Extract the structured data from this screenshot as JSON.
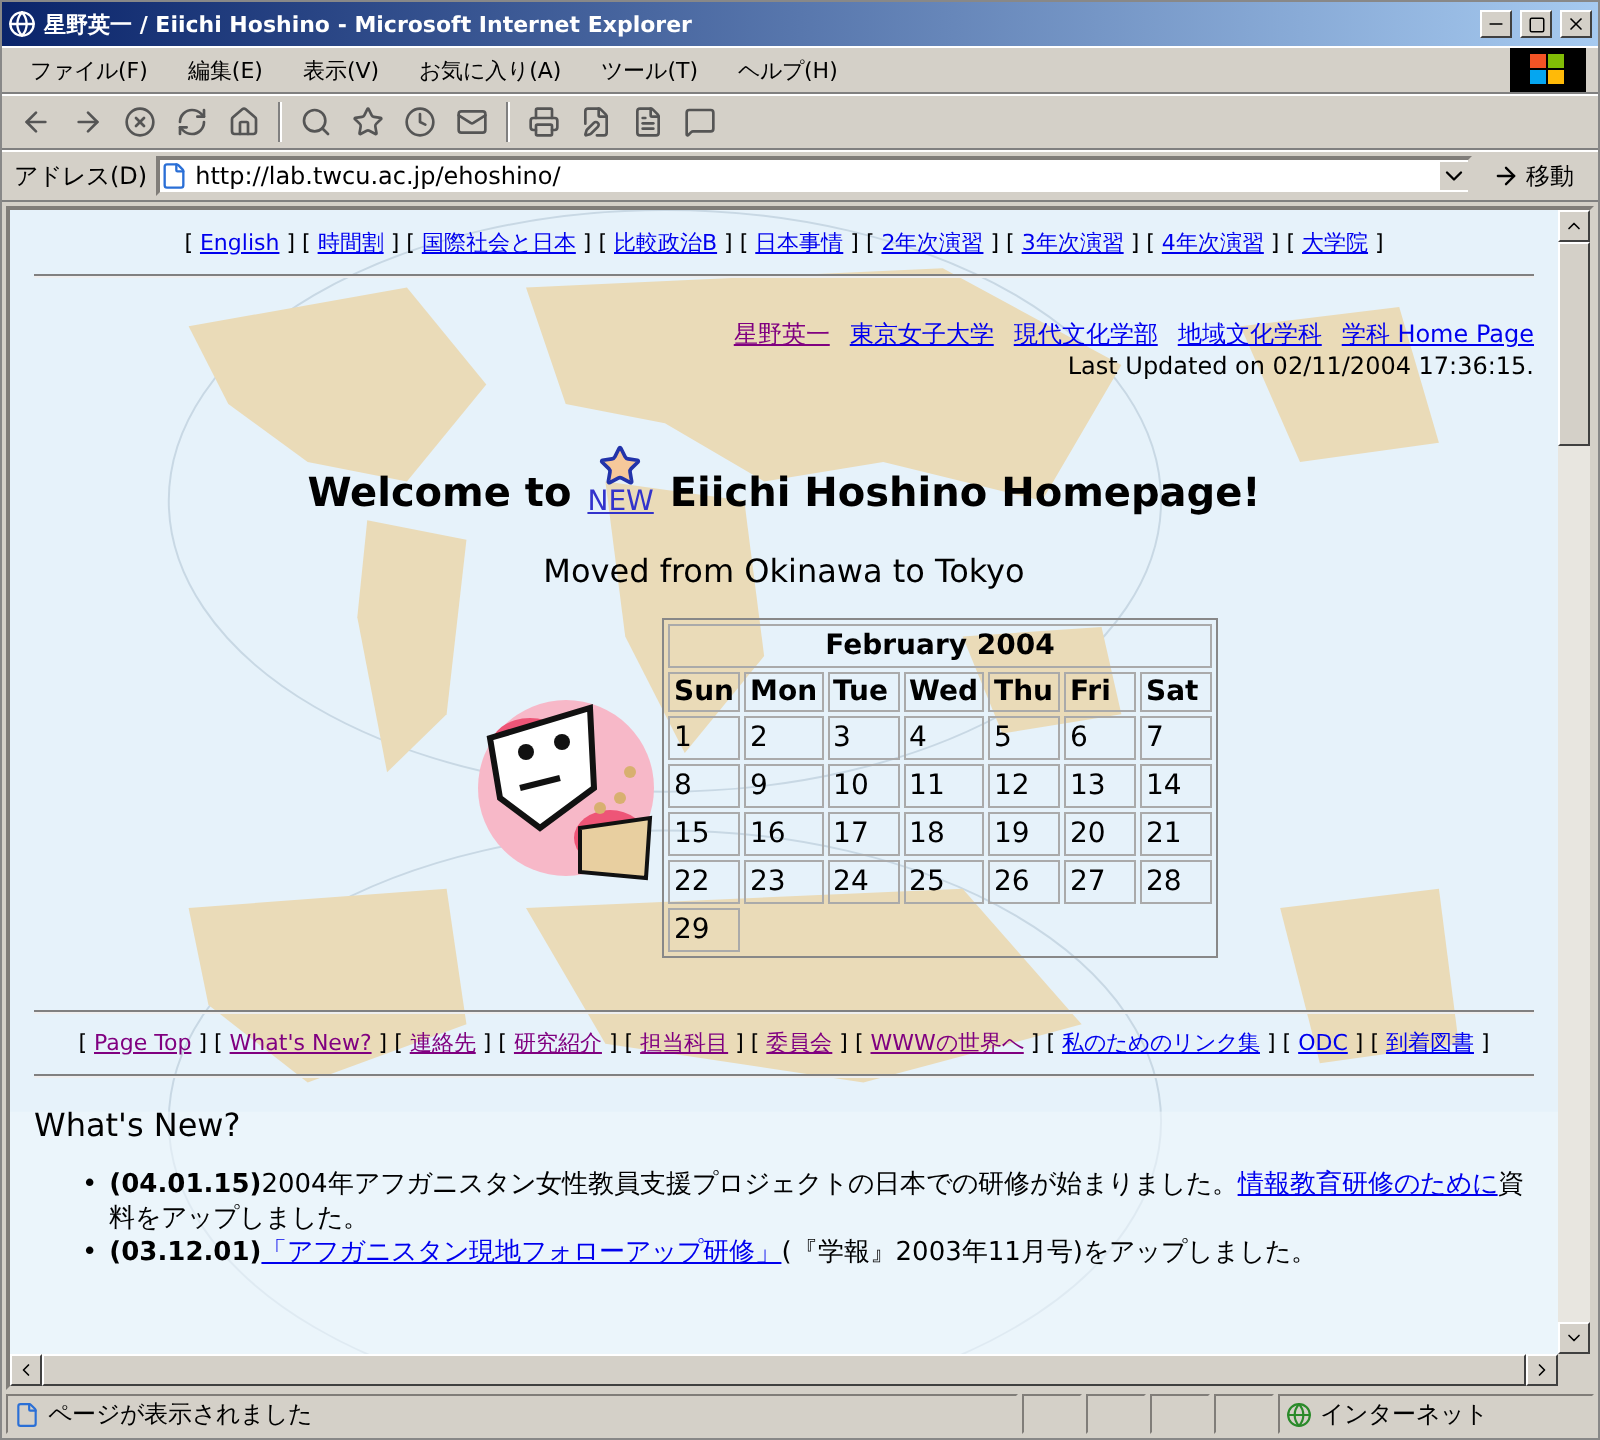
{
  "window": {
    "title": "星野英一 / Eiichi Hoshino - Microsoft Internet Explorer"
  },
  "menu": [
    "ファイル(F)",
    "編集(E)",
    "表示(V)",
    "お気に入り(A)",
    "ツール(T)",
    "ヘルプ(H)"
  ],
  "address": {
    "label": "アドレス(D)",
    "value": "http://lab.twcu.ac.jp/ehoshino/",
    "go": "移動"
  },
  "bracket_open": "[",
  "bracket_close": "]",
  "bullet": "•",
  "top_nav": [
    {
      "label": "English",
      "visited": false
    },
    {
      "label": "時間割",
      "visited": false
    },
    {
      "label": "国際社会と日本",
      "visited": false
    },
    {
      "label": "比較政治B",
      "visited": false
    },
    {
      "label": "日本事情",
      "visited": false
    },
    {
      "label": "2年次演習",
      "visited": false
    },
    {
      "label": "3年次演習",
      "visited": false
    },
    {
      "label": "4年次演習",
      "visited": false
    },
    {
      "label": "大学院",
      "visited": false
    }
  ],
  "affiliation": [
    {
      "label": "星野英一",
      "visited": true
    },
    {
      "label": "東京女子大学",
      "visited": false
    },
    {
      "label": "現代文化学部",
      "visited": false
    },
    {
      "label": "地域文化学科",
      "visited": false
    },
    {
      "label": "学科 Home Page",
      "visited": false
    }
  ],
  "last_updated": "Last Updated on 02/11/2004 17:36:15.",
  "heading": {
    "before": "Welcome to",
    "badge": "NEW",
    "after": "Eiichi Hoshino Homepage!"
  },
  "subheading": "Moved from Okinawa to Tokyo",
  "calendar": {
    "title": "February 2004",
    "weekdays": [
      "Sun",
      "Mon",
      "Tue",
      "Wed",
      "Thu",
      "Fri",
      "Sat"
    ],
    "weeks": [
      [
        "1",
        "2",
        "3",
        "4",
        "5",
        "6",
        "7"
      ],
      [
        "8",
        "9",
        "10",
        "11",
        "12",
        "13",
        "14"
      ],
      [
        "15",
        "16",
        "17",
        "18",
        "19",
        "20",
        "21"
      ],
      [
        "22",
        "23",
        "24",
        "25",
        "26",
        "27",
        "28"
      ],
      [
        "29"
      ]
    ]
  },
  "bottom_nav": [
    {
      "label": "Page Top",
      "visited": true
    },
    {
      "label": "What's New?",
      "visited": true
    },
    {
      "label": "連絡先",
      "visited": true
    },
    {
      "label": "研究紹介",
      "visited": true
    },
    {
      "label": "担当科目",
      "visited": true
    },
    {
      "label": "委員会",
      "visited": true
    },
    {
      "label": "WWWの世界へ",
      "visited": true
    },
    {
      "label": "私のためのリンク集",
      "visited": false
    },
    {
      "label": "ODC",
      "visited": false
    },
    {
      "label": "到着図書",
      "visited": false
    }
  ],
  "news_title": "What's New?",
  "news": [
    {
      "date": "(04.01.15)",
      "parts": [
        {
          "text": "2004年アフガニスタン女性教員支援プロジェクトの日本での研修が始まりました。",
          "link": false
        },
        {
          "text": "情報教育研修のために",
          "link": true
        },
        {
          "text": "資料をアップしました。",
          "link": false
        }
      ]
    },
    {
      "date": "(03.12.01)",
      "parts": [
        {
          "text": "「アフガニスタン現地フォローアップ研修」",
          "link": true
        },
        {
          "text": "(『学報』2003年11月号)をアップしました。",
          "link": false
        }
      ]
    }
  ],
  "status": {
    "text": "ページが表示されました",
    "zone": "インターネット"
  }
}
